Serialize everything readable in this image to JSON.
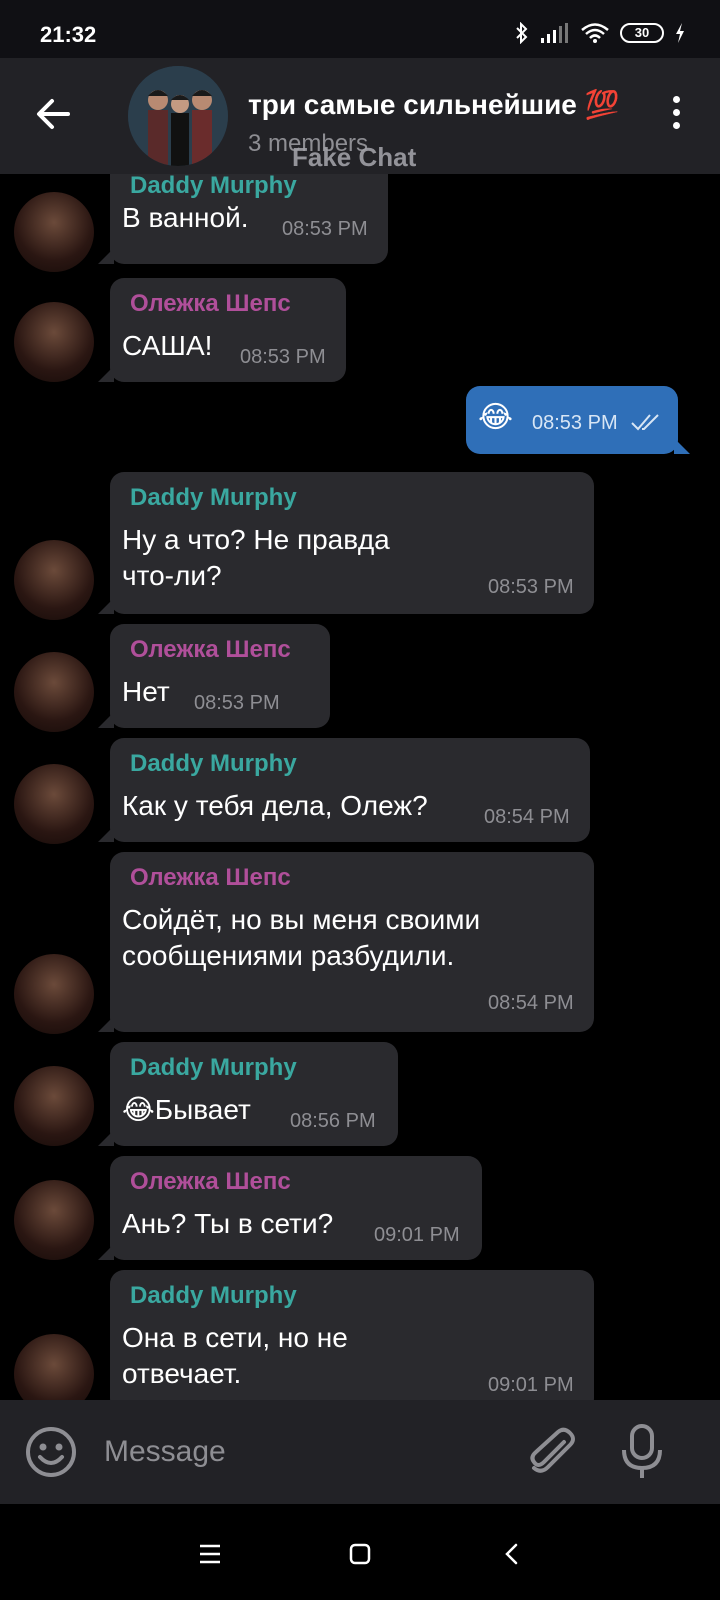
{
  "status_bar": {
    "time": "21:32",
    "battery": "30"
  },
  "header": {
    "title": "три самые сильнейшие 💯",
    "subtitle": "3 members",
    "watermark": "Fake Chat"
  },
  "messages": [
    {
      "sender": "Daddy Murphy",
      "text": "В ванной.",
      "time": "08:53 PM"
    },
    {
      "sender": "Олежка Шепс",
      "text": "САША!",
      "time": "08:53 PM"
    },
    {
      "outgoing": true,
      "text": "😂",
      "time": "08:53 PM",
      "status": "read"
    },
    {
      "sender": "Daddy Murphy",
      "text": "Ну а что? Не правда что-ли?",
      "time": "08:53 PM"
    },
    {
      "sender": "Олежка Шепс",
      "text": "Нет",
      "time": "08:53 PM"
    },
    {
      "sender": "Daddy Murphy",
      "text": "Как у тебя дела, Олеж?",
      "time": "08:54 PM"
    },
    {
      "sender": "Олежка Шепс",
      "text": "Сойдёт, но вы меня своими сообщениями разбудили.",
      "time": "08:54 PM"
    },
    {
      "sender": "Daddy Murphy",
      "text": "😂Бывает",
      "time": "08:56 PM"
    },
    {
      "sender": "Олежка Шепс",
      "text": "Ань? Ты в сети?",
      "time": "09:01 PM"
    },
    {
      "sender": "Daddy Murphy",
      "text": "Она в сети, но не отвечает.",
      "time": "09:01 PM"
    }
  ],
  "composer": {
    "placeholder": "Message"
  },
  "colors": {
    "daddy_name": "#3aa8a0",
    "olezhka_name": "#b04f9a",
    "outgoing_bubble": "#2f6fb8",
    "incoming_bubble": "#2a2a2e"
  }
}
